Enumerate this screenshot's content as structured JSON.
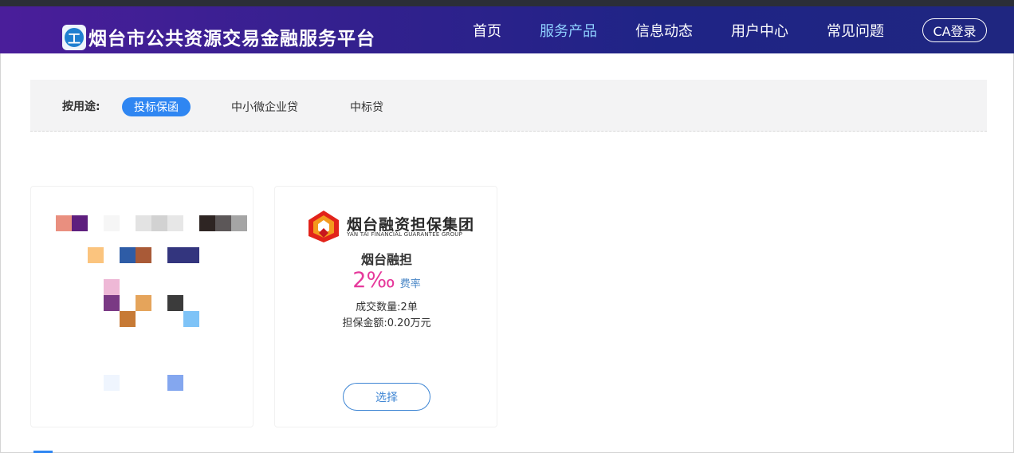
{
  "header": {
    "site_title": "烟台市公共资源交易金融服务平台",
    "logo_glyph": "工",
    "nav": [
      "首页",
      "服务产品",
      "信息动态",
      "用户中心",
      "常见问题"
    ],
    "active_nav": "服务产品",
    "ca_login": "CA登录"
  },
  "filter": {
    "label": "按用途:",
    "options": [
      "投标保函",
      "中小微企业贷",
      "中标贷"
    ],
    "selected": "投标保函"
  },
  "product_card": {
    "brand_name": "烟台融资担保集团",
    "brand_en": "YAN TAI FINANCIAL GUARANTEE GROUP",
    "company": "烟台融担",
    "rate": "2‰",
    "rate_label": "费率",
    "deal_count": "成交数量:2单",
    "guarantee_amount": "担保金额:0.20万元",
    "select_label": "选择"
  },
  "colors": {
    "header_start": "#4a1e9a",
    "header_end": "#1f2680",
    "accent_blue": "#2f86f2",
    "rate_pink": "#e6399b",
    "nav_active": "#8fd0ff"
  }
}
